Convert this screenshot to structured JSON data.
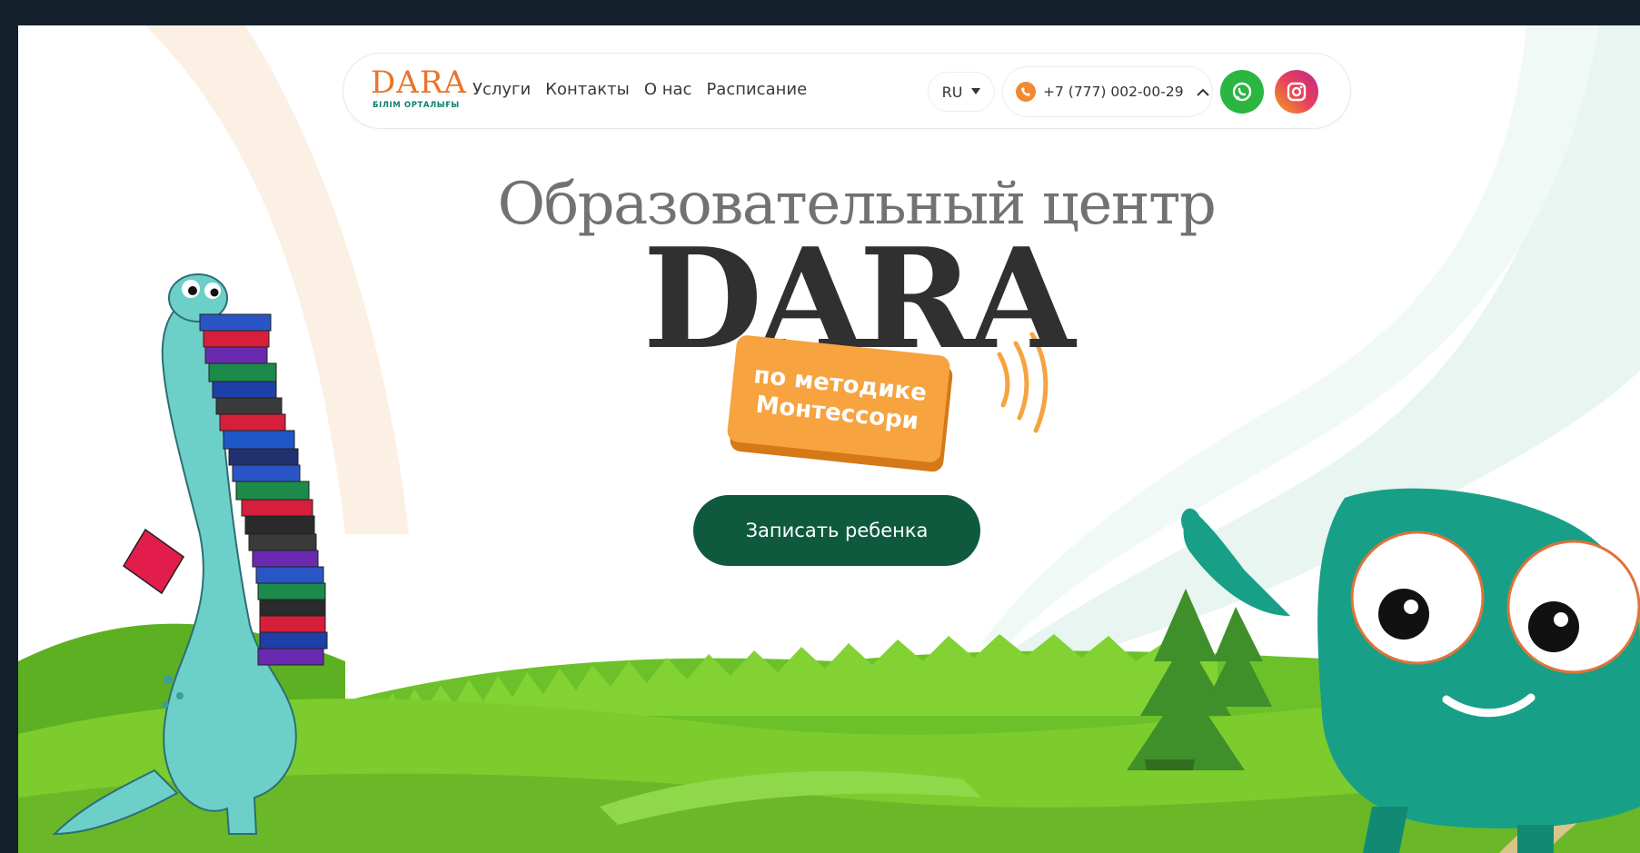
{
  "header": {
    "logo": {
      "word": "DARA",
      "subtitle": "БІЛІМ ОРТАЛЫҒЫ"
    },
    "nav": [
      "Услуги",
      "Контакты",
      "О нас",
      "Расписание"
    ],
    "language": "RU",
    "phone": "+7 (777) 002-00-29"
  },
  "hero": {
    "subtitle": "Образовательный центр",
    "title": "DARA",
    "badge_line1": "по методике",
    "badge_line2": "Монтессори",
    "cta_label": "Записать ребенка"
  },
  "colors": {
    "brand_orange": "#f6a340",
    "cta_green": "#0f5a3e",
    "whatsapp": "#2bb541",
    "grass": "#7ccc2e",
    "mascot_teal": "#17a087",
    "dino_blue": "#6dd0c8"
  },
  "icons": [
    "phone-icon",
    "whatsapp-icon",
    "instagram-icon",
    "chevron-down-icon",
    "chevron-up-icon"
  ]
}
